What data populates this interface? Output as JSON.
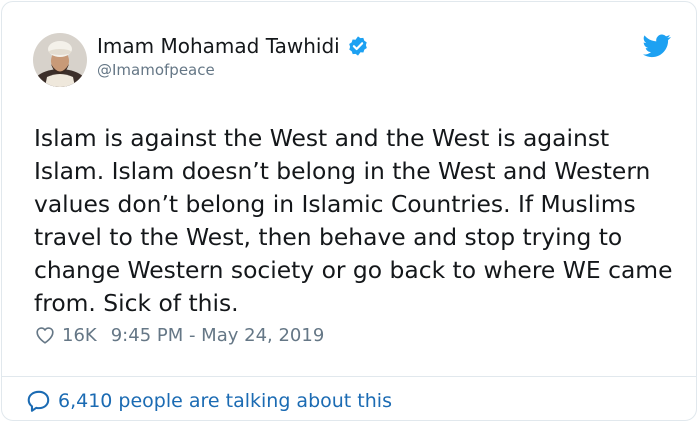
{
  "author": {
    "name": "Imam Mohamad Tawhidi",
    "handle": "@Imamofpeace",
    "avatar_icon": "profile-photo",
    "verified_icon": "verified-badge-icon"
  },
  "brand": {
    "logo_icon": "twitter-bird-icon",
    "color": "#1da1f2"
  },
  "tweet": {
    "text": "Islam is against the West and the West is against Islam. Islam doesn’t belong in the West and Western values don’t belong in Islamic Countries. If Muslims travel to the West, then behave and stop trying to change Western society or go back to where WE came from. Sick of this."
  },
  "meta": {
    "like_icon": "heart-icon",
    "likes": "16K",
    "timestamp": "9:45 PM - May 24, 2019"
  },
  "footer": {
    "icon": "speech-bubble-icon",
    "talking_text": "6,410 people are talking about this",
    "link_color": "#1b6bb3"
  }
}
